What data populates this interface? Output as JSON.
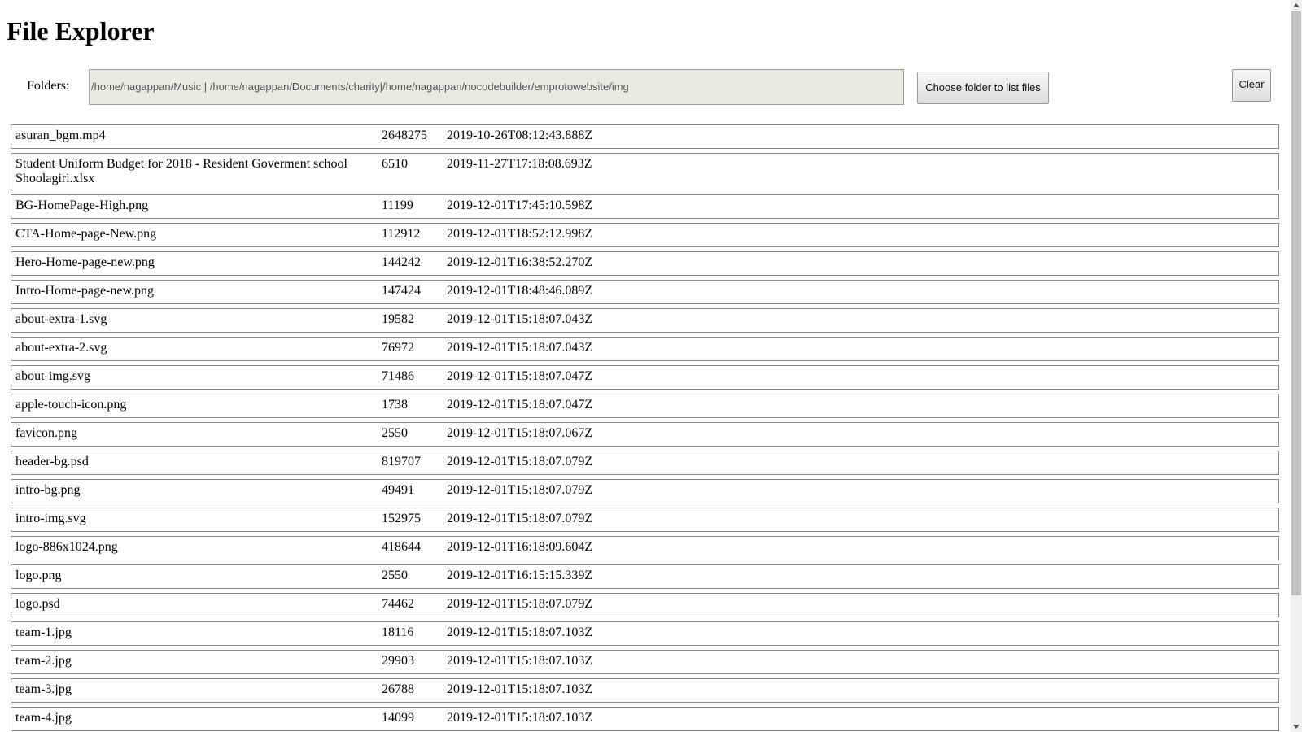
{
  "title": "File Explorer",
  "folders_label": "Folders:",
  "folders_value": "/home/nagappan/Music | /home/nagappan/Documents/charity|/home/nagappan/nocodebuilder/emprotowebsite/img",
  "choose_label": "Choose folder to list files",
  "clear_label": "Clear",
  "files": [
    {
      "name": "asuran_bgm.mp4",
      "size": "2648275",
      "date": "2019-10-26T08:12:43.888Z"
    },
    {
      "name": "Student Uniform Budget for 2018 - Resident Goverment school Shoolagiri.xlsx",
      "size": "6510",
      "date": "2019-11-27T17:18:08.693Z"
    },
    {
      "name": "BG-HomePage-High.png",
      "size": "11199",
      "date": "2019-12-01T17:45:10.598Z"
    },
    {
      "name": "CTA-Home-page-New.png",
      "size": "112912",
      "date": "2019-12-01T18:52:12.998Z"
    },
    {
      "name": "Hero-Home-page-new.png",
      "size": "144242",
      "date": "2019-12-01T16:38:52.270Z"
    },
    {
      "name": "Intro-Home-page-new.png",
      "size": "147424",
      "date": "2019-12-01T18:48:46.089Z"
    },
    {
      "name": "about-extra-1.svg",
      "size": "19582",
      "date": "2019-12-01T15:18:07.043Z"
    },
    {
      "name": "about-extra-2.svg",
      "size": "76972",
      "date": "2019-12-01T15:18:07.043Z"
    },
    {
      "name": "about-img.svg",
      "size": "71486",
      "date": "2019-12-01T15:18:07.047Z"
    },
    {
      "name": "apple-touch-icon.png",
      "size": "1738",
      "date": "2019-12-01T15:18:07.047Z"
    },
    {
      "name": "favicon.png",
      "size": "2550",
      "date": "2019-12-01T15:18:07.067Z"
    },
    {
      "name": "header-bg.psd",
      "size": "819707",
      "date": "2019-12-01T15:18:07.079Z"
    },
    {
      "name": "intro-bg.png",
      "size": "49491",
      "date": "2019-12-01T15:18:07.079Z"
    },
    {
      "name": "intro-img.svg",
      "size": "152975",
      "date": "2019-12-01T15:18:07.079Z"
    },
    {
      "name": "logo-886x1024.png",
      "size": "418644",
      "date": "2019-12-01T16:18:09.604Z"
    },
    {
      "name": "logo.png",
      "size": "2550",
      "date": "2019-12-01T16:15:15.339Z"
    },
    {
      "name": "logo.psd",
      "size": "74462",
      "date": "2019-12-01T15:18:07.079Z"
    },
    {
      "name": "team-1.jpg",
      "size": "18116",
      "date": "2019-12-01T15:18:07.103Z"
    },
    {
      "name": "team-2.jpg",
      "size": "29903",
      "date": "2019-12-01T15:18:07.103Z"
    },
    {
      "name": "team-3.jpg",
      "size": "26788",
      "date": "2019-12-01T15:18:07.103Z"
    },
    {
      "name": "team-4.jpg",
      "size": "14099",
      "date": "2019-12-01T15:18:07.103Z"
    }
  ]
}
